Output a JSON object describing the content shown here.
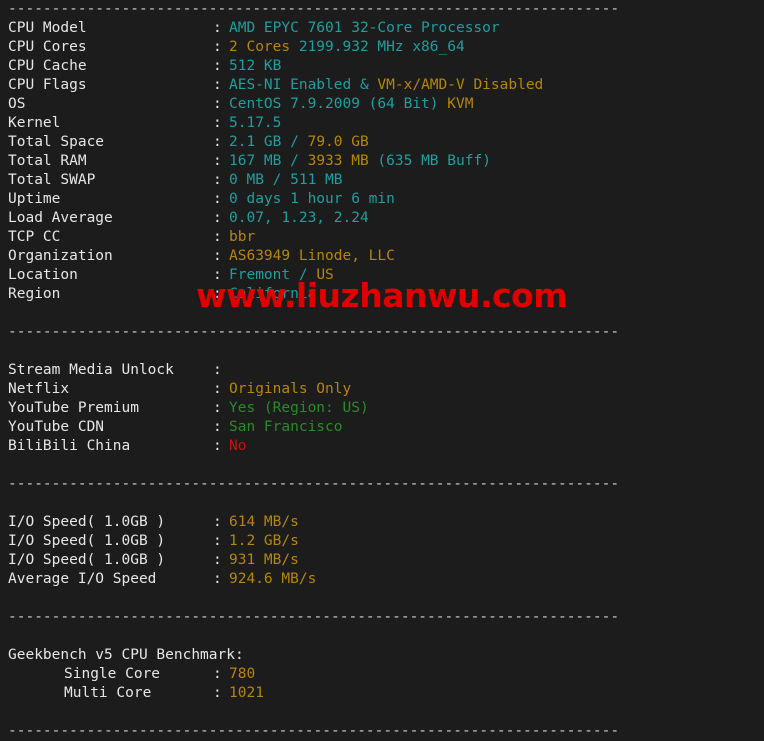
{
  "terminal": {
    "background_color": "#1c1c1c",
    "label_color": "#e6e6e6",
    "colors": {
      "cyan": "#1f9e9e",
      "orange": "#b5860b",
      "green": "#2a8a2a",
      "red": "#cc0e0e",
      "white": "#e6e6e6"
    },
    "separator": "----------------------------------------------------------------------",
    "colon": ":"
  },
  "watermark": {
    "text": "www.liuzhanwu.com",
    "color": "#e00000"
  },
  "sections": [
    {
      "id": "system-info",
      "rows": [
        {
          "label": "CPU Model",
          "parts": [
            {
              "text": "AMD EPYC 7601 32-Core Processor",
              "color": "cyan"
            }
          ]
        },
        {
          "label": "CPU Cores",
          "parts": [
            {
              "text": "2 Cores",
              "color": "orange"
            },
            {
              "text": " 2199.932 MHz x86_64",
              "color": "cyan"
            }
          ]
        },
        {
          "label": "CPU Cache",
          "parts": [
            {
              "text": "512 KB",
              "color": "cyan"
            }
          ]
        },
        {
          "label": "CPU Flags",
          "parts": [
            {
              "text": "AES-NI Enabled",
              "color": "cyan"
            },
            {
              "text": " & ",
              "color": "cyan"
            },
            {
              "text": "VM-x/AMD-V Disabled",
              "color": "orange"
            }
          ]
        },
        {
          "label": "OS",
          "parts": [
            {
              "text": "CentOS 7.9.2009 (64 Bit) ",
              "color": "cyan"
            },
            {
              "text": "KVM",
              "color": "orange"
            }
          ]
        },
        {
          "label": "Kernel",
          "parts": [
            {
              "text": "5.17.5",
              "color": "cyan"
            }
          ]
        },
        {
          "label": "Total Space",
          "parts": [
            {
              "text": "2.1 GB",
              "color": "cyan"
            },
            {
              "text": " / ",
              "color": "cyan"
            },
            {
              "text": "79.0 GB",
              "color": "orange"
            }
          ]
        },
        {
          "label": "Total RAM",
          "parts": [
            {
              "text": "167 MB",
              "color": "cyan"
            },
            {
              "text": " / ",
              "color": "cyan"
            },
            {
              "text": "3933 MB",
              "color": "orange"
            },
            {
              "text": " (635 MB Buff)",
              "color": "cyan"
            }
          ]
        },
        {
          "label": "Total SWAP",
          "parts": [
            {
              "text": "0 MB / 511 MB",
              "color": "cyan"
            }
          ]
        },
        {
          "label": "Uptime",
          "parts": [
            {
              "text": "0 days 1 hour 6 min",
              "color": "cyan"
            }
          ]
        },
        {
          "label": "Load Average",
          "parts": [
            {
              "text": "0.07, 1.23, 2.24",
              "color": "cyan"
            }
          ]
        },
        {
          "label": "TCP CC",
          "parts": [
            {
              "text": "bbr",
              "color": "orange"
            }
          ]
        },
        {
          "label": "Organization",
          "parts": [
            {
              "text": "AS63949 Linode, LLC",
              "color": "orange"
            }
          ]
        },
        {
          "label": "Location",
          "parts": [
            {
              "text": "Fremont",
              "color": "cyan"
            },
            {
              "text": " / ",
              "color": "cyan"
            },
            {
              "text": "US",
              "color": "orange"
            }
          ]
        },
        {
          "label": "Region",
          "parts": [
            {
              "text": "California",
              "color": "cyan"
            }
          ]
        }
      ]
    },
    {
      "id": "stream-media-unlock",
      "rows": [
        {
          "label": "Stream Media Unlock",
          "parts": []
        },
        {
          "label": "Netflix",
          "parts": [
            {
              "text": "Originals Only",
              "color": "orange"
            }
          ]
        },
        {
          "label": "YouTube Premium",
          "parts": [
            {
              "text": "Yes (Region: US)",
              "color": "green"
            }
          ]
        },
        {
          "label": "YouTube CDN",
          "parts": [
            {
              "text": "San Francisco",
              "color": "green"
            }
          ]
        },
        {
          "label": "BiliBili China",
          "parts": [
            {
              "text": "No",
              "color": "red"
            }
          ]
        }
      ]
    },
    {
      "id": "io-speed",
      "rows": [
        {
          "label": "I/O Speed( 1.0GB )",
          "parts": [
            {
              "text": "614 MB/s",
              "color": "orange"
            }
          ]
        },
        {
          "label": "I/O Speed( 1.0GB )",
          "parts": [
            {
              "text": "1.2 GB/s",
              "color": "orange"
            }
          ]
        },
        {
          "label": "I/O Speed( 1.0GB )",
          "parts": [
            {
              "text": "931 MB/s",
              "color": "orange"
            }
          ]
        },
        {
          "label": "Average I/O Speed",
          "parts": [
            {
              "text": "924.6 MB/s",
              "color": "orange"
            }
          ]
        }
      ]
    },
    {
      "id": "geekbench",
      "heading": "Geekbench v5 CPU Benchmark:",
      "rows": [
        {
          "label": "Single Core",
          "indent": true,
          "parts": [
            {
              "text": "780",
              "color": "orange"
            }
          ]
        },
        {
          "label": "Multi Core",
          "indent": true,
          "parts": [
            {
              "text": "1021",
              "color": "orange"
            }
          ]
        }
      ]
    }
  ]
}
